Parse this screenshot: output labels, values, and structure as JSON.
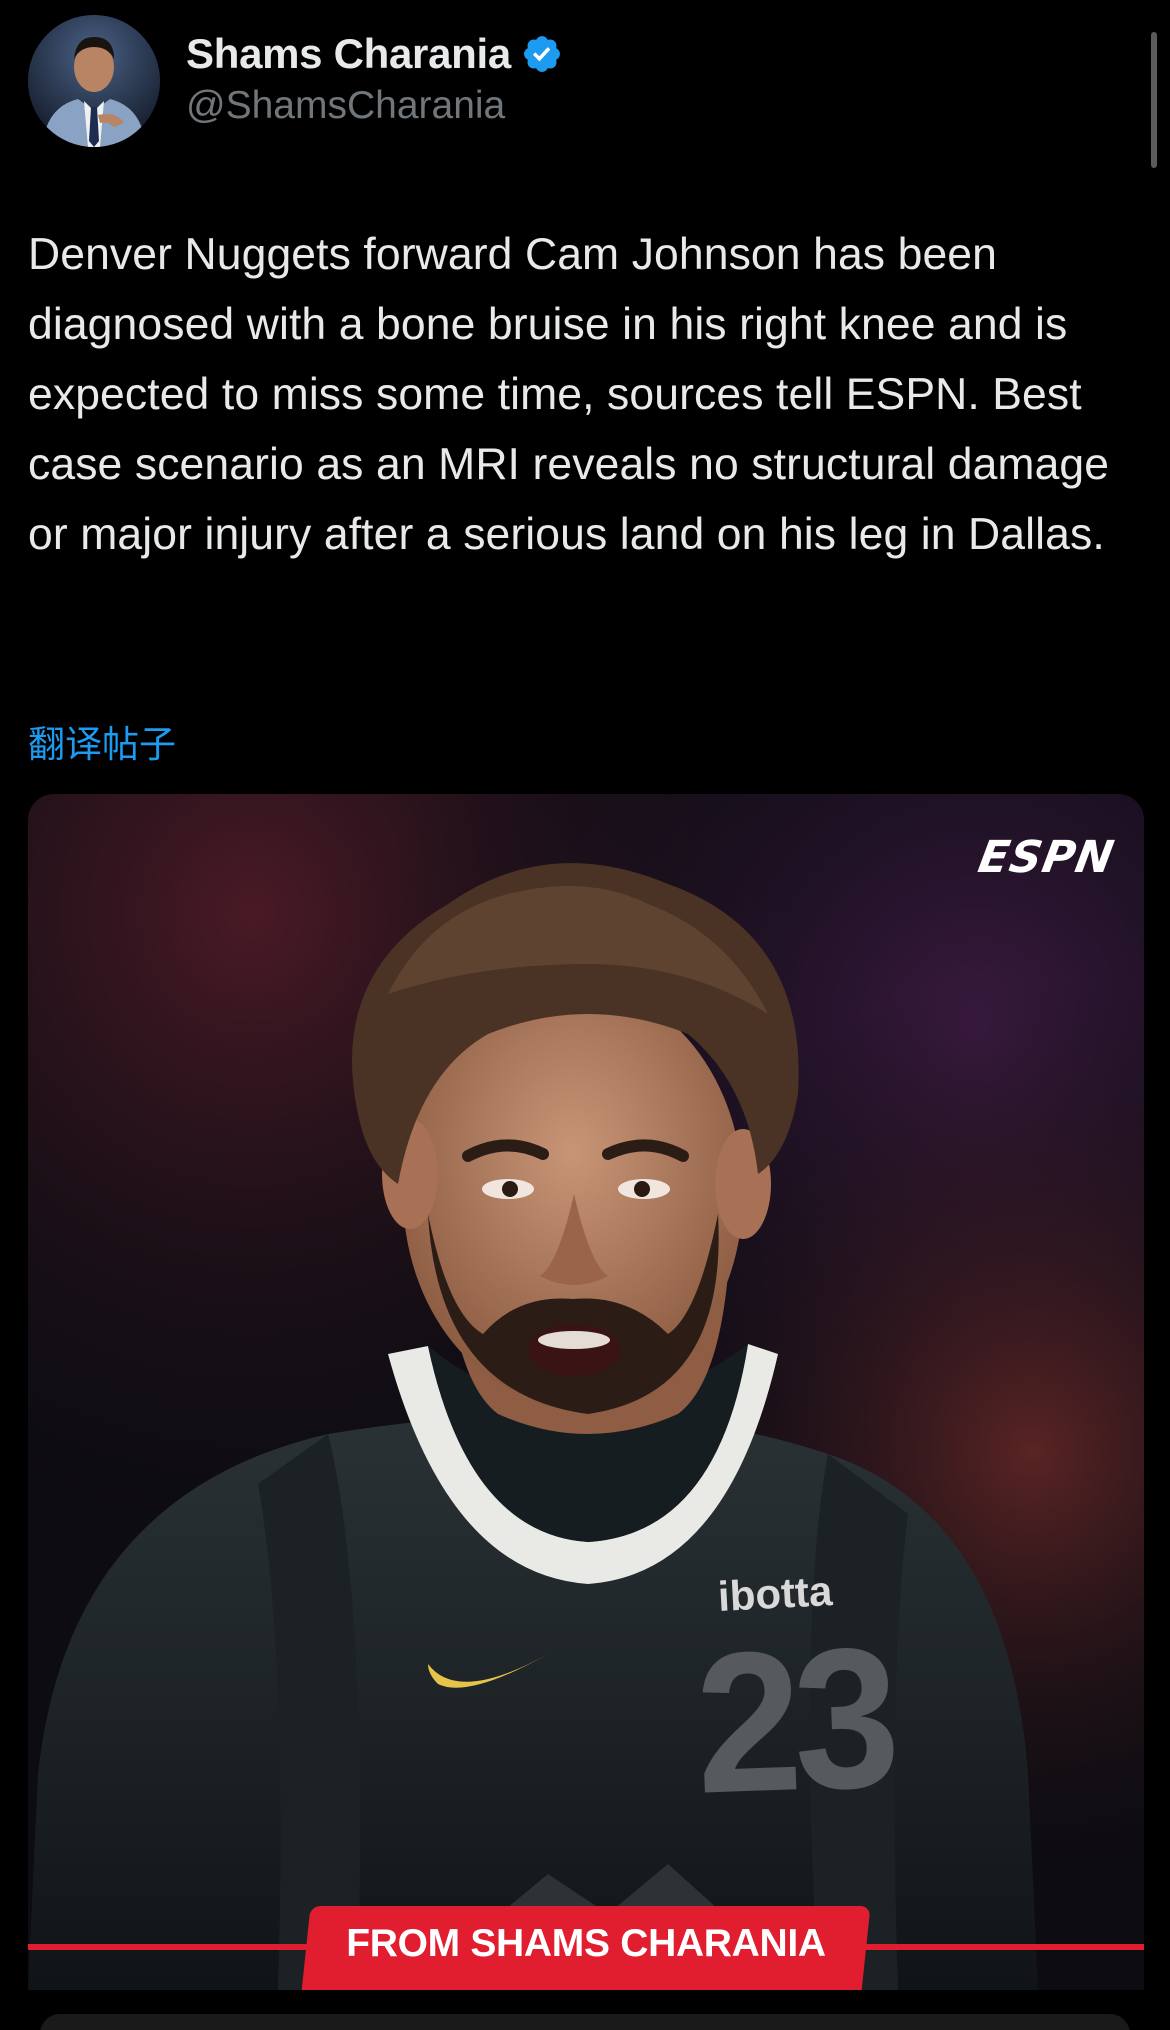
{
  "post": {
    "author": {
      "display_name": "Shams Charania",
      "handle": "@ShamsCharania",
      "verified": true,
      "avatar_icon": "profile-photo"
    },
    "text": "Denver Nuggets forward Cam Johnson has been diagnosed with a bone bruise in his right knee and is expected to miss some time, sources tell ESPN. Best case scenario as an MRI reveals no structural damage or major injury after a serious land on his leg in Dallas.",
    "translate_label": "翻译帖子"
  },
  "media": {
    "logo_text": "ESPN",
    "jersey_sponsor": "ibotta",
    "jersey_number": "23",
    "credit_banner": "FROM SHAMS CHARANIA"
  },
  "colors": {
    "background": "#000000",
    "text": "#e7e9ea",
    "secondary_text": "#71767b",
    "link": "#1d9bf0",
    "verified_badge": "#1d9bf0",
    "espn_red": "#e01e2f"
  }
}
